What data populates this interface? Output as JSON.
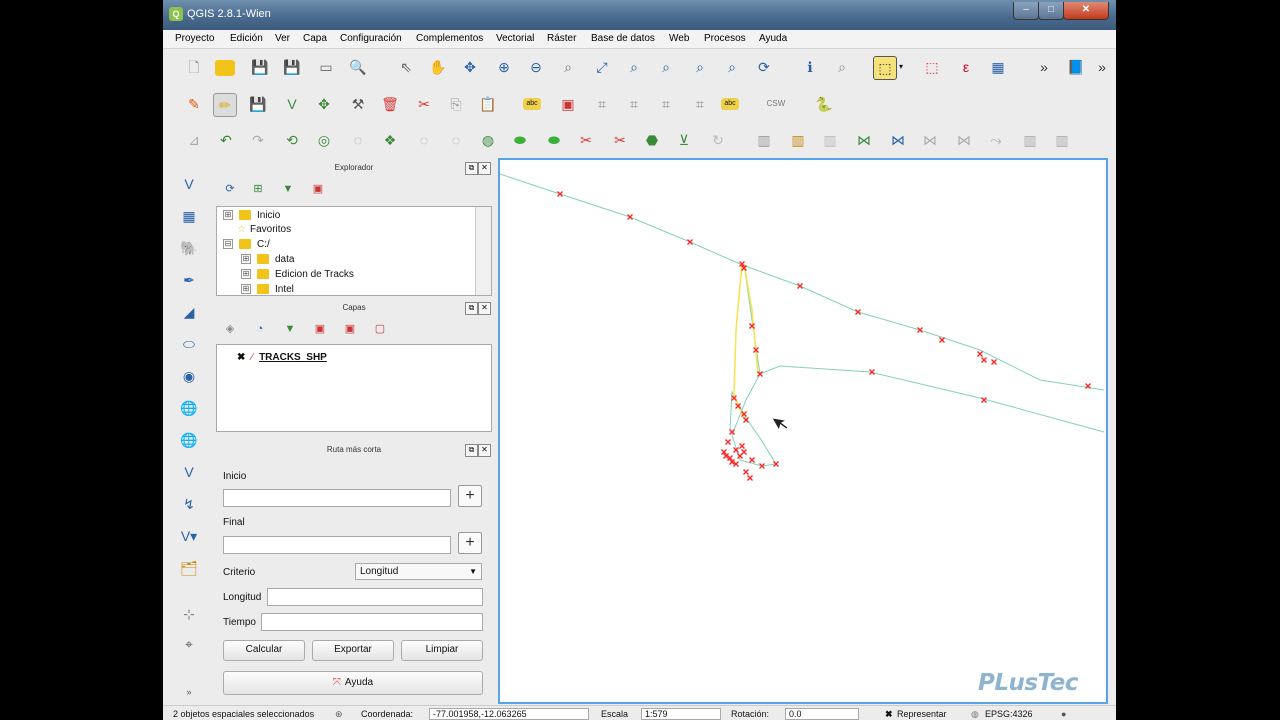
{
  "window": {
    "title": "QGIS 2.8.1-Wien",
    "app_icon": "Q",
    "minimize": "–",
    "maximize": "□",
    "close": "✕"
  },
  "menu": [
    "Proyecto",
    "Edición",
    "Ver",
    "Capa",
    "Configuración",
    "Complementos",
    "Vectorial",
    "Ráster",
    "Base de datos",
    "Web",
    "Procesos",
    "Ayuda"
  ],
  "explorer": {
    "title": "Explorador",
    "tree": [
      {
        "label": "Inicio",
        "kind": "folder",
        "expander": "⊞"
      },
      {
        "label": "Favoritos",
        "kind": "star"
      },
      {
        "label": "C:/",
        "kind": "folder",
        "expander": "⊟"
      },
      {
        "label": "data",
        "kind": "folder",
        "expander": "⊞"
      },
      {
        "label": "Edicion de Tracks",
        "kind": "folder",
        "expander": "⊞"
      },
      {
        "label": "Intel",
        "kind": "folder",
        "expander": "⊞"
      }
    ]
  },
  "layers": {
    "title": "Capas",
    "items": [
      {
        "name": "TRACKS_SHP",
        "checked": true
      }
    ]
  },
  "route": {
    "title": "Ruta más corta",
    "start_label": "Inicio",
    "end_label": "Final",
    "criteria_label": "Criterio",
    "criteria_value": "Longitud",
    "length_label": "Longitud",
    "time_label": "Tiempo",
    "calculate": "Calcular",
    "export": "Exportar",
    "clear": "Limpiar",
    "help": "Ayuda"
  },
  "status": {
    "selected": "2 objetos espaciales seleccionados",
    "coord_label": "Coordenada:",
    "coord_value": "-77.001958,-12.063265",
    "scale_label": "Escala",
    "scale_value": "1:579",
    "rotation_label": "Rotación:",
    "rotation_value": "0.0",
    "render_label": "Representar",
    "crs": "EPSG:4326"
  },
  "logo": "PLusTec",
  "colors": {
    "track_line": "#7fd3b9",
    "selected_line": "#f5e45a",
    "vertex_marker": "#ff2020",
    "canvas_border": "#57a4e8"
  }
}
